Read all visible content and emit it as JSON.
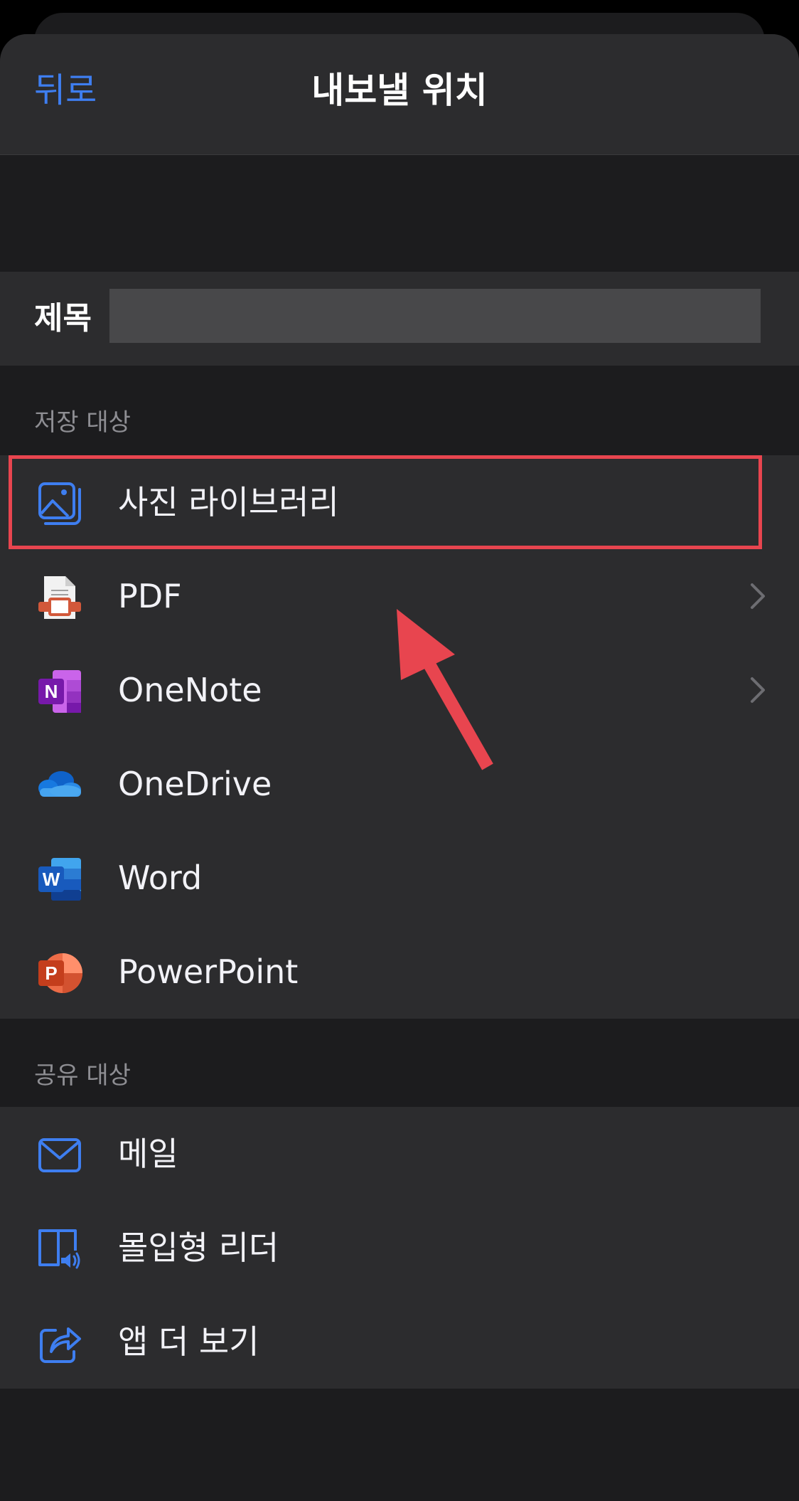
{
  "navbar": {
    "back_label": "뒤로",
    "title": "내보낼 위치"
  },
  "title_row": {
    "label": "제목",
    "value": ""
  },
  "save_section": {
    "header": "저장 대상",
    "items": [
      {
        "label": "사진 라이브러리",
        "icon": "photo-library-icon",
        "chevron": false
      },
      {
        "label": "PDF",
        "icon": "pdf-icon",
        "chevron": true
      },
      {
        "label": "OneNote",
        "icon": "onenote-icon",
        "chevron": true
      },
      {
        "label": "OneDrive",
        "icon": "onedrive-icon",
        "chevron": false
      },
      {
        "label": "Word",
        "icon": "word-icon",
        "chevron": false
      },
      {
        "label": "PowerPoint",
        "icon": "powerpoint-icon",
        "chevron": false
      }
    ]
  },
  "share_section": {
    "header": "공유 대상",
    "items": [
      {
        "label": "메일",
        "icon": "mail-icon"
      },
      {
        "label": "몰입형 리더",
        "icon": "immersive-reader-icon"
      },
      {
        "label": "앱 더 보기",
        "icon": "share-icon"
      }
    ]
  },
  "colors": {
    "accent": "#3e7ef0",
    "highlight": "#e8454f",
    "background": "#1c1c1e",
    "row_background": "#2c2c2e"
  }
}
